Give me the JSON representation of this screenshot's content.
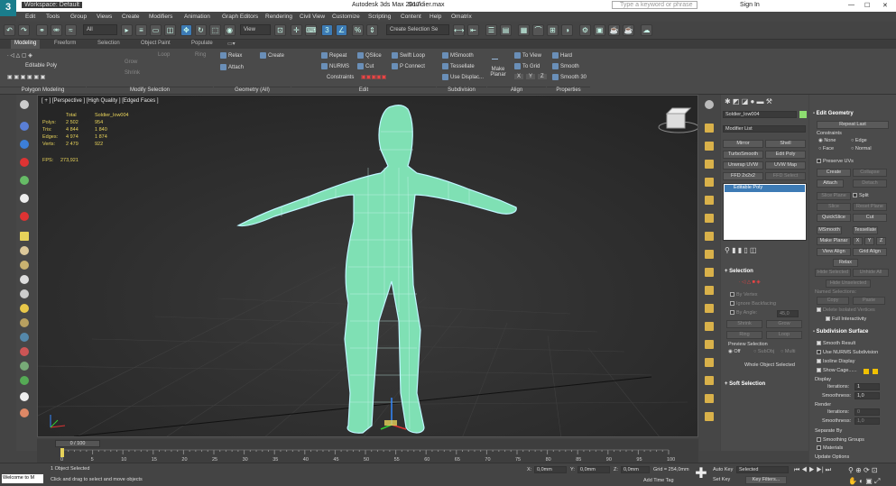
{
  "window": {
    "title": "Autodesk 3ds Max 2017",
    "filename": "Souldier.max",
    "workspace": "Workspace: Default",
    "search_placeholder": "Type a keyword or phrase",
    "sign_in": "Sign In"
  },
  "menu": [
    "Edit",
    "Tools",
    "Group",
    "Views",
    "Create",
    "Modifiers",
    "Animation",
    "Graph Editors",
    "Rendering",
    "Civil View",
    "Customize",
    "Scripting",
    "Content",
    "Help",
    "Omatrix"
  ],
  "toolbar": {
    "filter": "All",
    "view": "View",
    "selection_set": "Create Selection Se"
  },
  "ribbon_tabs": [
    "Modeling",
    "Freeform",
    "Selection",
    "Object Paint",
    "Populate"
  ],
  "ribbon": {
    "polygon_modeling": {
      "label": "Editable Poly",
      "footer": "Polygon Modeling"
    },
    "modify_selection": {
      "grow": "Grow",
      "shrink": "Shrink",
      "loop": "Loop",
      "ring": "Ring",
      "footer": "Modify Selection"
    },
    "geometry": {
      "relax": "Relax",
      "create": "Create",
      "attach": "Attach",
      "footer": "Geometry (All)"
    },
    "edit": {
      "repeat": "Repeat",
      "qslice": "QSlice",
      "swift_loop": "Swift Loop",
      "nurms": "NURMS",
      "cut": "Cut",
      "p_connect": "P Connect",
      "constraints": "Constraints",
      "footer": "Edit"
    },
    "subdivision": {
      "msmooth": "MSmooth",
      "tessellate": "Tessellate",
      "use_displac": "Use Displac...",
      "footer": "Subdivision"
    },
    "align": {
      "make_planar": "Make Planar",
      "to_view": "To View",
      "to_grid": "To Grid",
      "x": "X",
      "y": "Y",
      "z": "Z",
      "footer": "Align"
    },
    "properties": {
      "hard": "Hard",
      "smooth": "Smooth",
      "smooth30": "Smooth 30",
      "footer": "Properties"
    }
  },
  "viewport": {
    "label": "[ + ] [Perspective ] [High Quality ] [Edged Faces ]",
    "stats": {
      "col_total": "Total",
      "col_obj": "Soldier_low004",
      "rows": [
        [
          "Polys:",
          "2 502",
          "954"
        ],
        [
          "Tris:",
          "4 844",
          "1 840"
        ],
        [
          "Edges:",
          "4 974",
          "1 874"
        ],
        [
          "Verts:",
          "2 479",
          "922"
        ]
      ],
      "fps_label": "FPS:",
      "fps": "273,921"
    }
  },
  "command_panel": {
    "object_name": "Soldier_low004",
    "modifier_list": "Modifier List",
    "buttons": [
      "Mirror",
      "Shell",
      "TurboSmooth",
      "Edit Poly",
      "Unwrap UVW",
      "UVW Map",
      "FFD 2x2x2",
      "FFD Select"
    ],
    "stack_item": "Editable Poly",
    "selection": {
      "title": "Selection",
      "by_vertex": "By Vertex",
      "ignore_backfacing": "Ignore Backfacing",
      "by_angle": "By Angle:",
      "angle": "45,0",
      "shrink": "Shrink",
      "grow": "Grow",
      "ring": "Ring",
      "loop": "Loop",
      "preview_selection": "Preview Selection",
      "off": "Off",
      "subobj": "SubObj",
      "multi": "Multi",
      "whole_object": "Whole Object Selected"
    },
    "soft_selection": "Soft Selection"
  },
  "edit_geometry": {
    "title": "Edit Geometry",
    "repeat_last": "Repeat Last",
    "constraints": "Constraints",
    "none": "None",
    "edge": "Edge",
    "face": "Face",
    "normal": "Normal",
    "preserve_uvs": "Preserve UVs",
    "create": "Create",
    "collapse": "Collapse",
    "attach": "Attach",
    "detach": "Detach",
    "slice_plane": "Slice Plane",
    "split": "Split",
    "slice": "Slice",
    "reset_plane": "Reset Plane",
    "quickslice": "QuickSlice",
    "cut": "Cut",
    "msmooth": "MSmooth",
    "tessellate": "Tessellate",
    "make_planar": "Make Planar",
    "x": "X",
    "y": "Y",
    "z": "Z",
    "view_align": "View Align",
    "grid_align": "Grid Align",
    "relax": "Relax",
    "hide_selected": "Hide Selected",
    "unhide_all": "Unhide All",
    "hide_unselected": "Hide Unselected",
    "named_selections": "Named Selections:",
    "copy": "Copy",
    "paste": "Paste",
    "delete_isolated": "Delete Isolated Vertices",
    "full_interactivity": "Full Interactivity",
    "subdivision_surface": "Subdivision Surface",
    "smooth_result": "Smooth Result",
    "use_nurms": "Use NURMS Subdivision",
    "isoline": "Isoline Display",
    "show_cage": "Show Cage......",
    "display": "Display",
    "iterations": "Iterations:",
    "iter_val": "1",
    "smoothness": "Smoothness:",
    "smooth_val": "1,0",
    "render": "Render",
    "r_iterations": "Iterations:",
    "r_iter_val": "0",
    "r_smoothness": "Smoothness:",
    "r_smooth_val": "1,0",
    "separate_by": "Separate By",
    "smoothing_groups": "Smoothing Groups",
    "materials": "Materials",
    "update_options": "Update Options"
  },
  "timeline": {
    "frame": "0 / 100",
    "ticks": [
      "0",
      "5",
      "10",
      "15",
      "20",
      "25",
      "30",
      "35",
      "40",
      "45",
      "50",
      "55",
      "60",
      "65",
      "70",
      "75",
      "80",
      "85",
      "90",
      "95",
      "100"
    ]
  },
  "status": {
    "maxscript": "Welcome to M",
    "selected": "1 Object Selected",
    "hint": "Click and drag to select and move objects",
    "x": "0,0mm",
    "y": "0,0mm",
    "z": "0,0mm",
    "grid": "Grid = 254,0mm",
    "add_time_tag": "Add Time Tag",
    "auto_key": "Auto Key",
    "selected_dd": "Selected",
    "set_key": "Set Key",
    "key_filters": "Key Filters..."
  },
  "colors": {
    "mesh": "#7fe0b4",
    "mesh_outline": "#bff6ff",
    "accent": "#3d7bb5",
    "stats_text": "#e8d35a",
    "object_swatch": "#8ddc70"
  }
}
